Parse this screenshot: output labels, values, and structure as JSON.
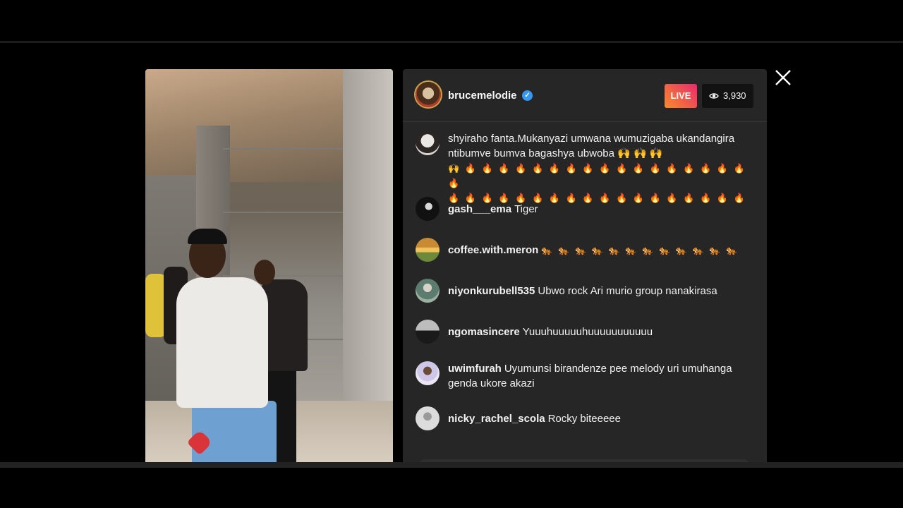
{
  "host": {
    "username": "brucemelodie",
    "verified_icon": "verified-badge-icon",
    "live_label": "LIVE",
    "viewer_count": "3,930"
  },
  "comments": [
    {
      "username": "",
      "text": "shyiraho fanta.Mukanyazi umwana wumuzigaba ukandangira ntibumve bumva bagashya ubwoba 🙌 🙌 🙌",
      "emojis": "🙌 🔥 🔥 🔥 🔥 🔥 🔥 🔥 🔥 🔥 🔥 🔥 🔥 🔥 🔥 🔥 🔥 🔥 🔥\n🔥 🔥 🔥 🔥 🔥 🔥 🔥 🔥 🔥 🔥 🔥 🔥 🔥 🔥 🔥 🔥 🔥 🔥"
    },
    {
      "username": "gash___ema",
      "text": "Tiger"
    },
    {
      "username": "coffee.with.meron",
      "text": "🐅 🐅 🐅 🐅 🐅 🐅 🐅 🐅 🐅 🐅 🐅 🐅"
    },
    {
      "username": "niyonkurubell535",
      "text": "Ubwo rock Ari murio group nanakirasa"
    },
    {
      "username": "ngomasincere",
      "text": "Yuuuhuuuuuhuuuuuuuuuuu"
    },
    {
      "username": "uwimfurah",
      "text": "Uyumunsi birandenze pee melody uri umuhanga genda ukore akazi"
    },
    {
      "username": "nicky_rachel_scola",
      "text": "Rocky biteeeee"
    }
  ],
  "colors": {
    "panel_bg": "#262626",
    "live_gradient_start": "#f78c2b",
    "live_gradient_end": "#ea2a6d",
    "verified_blue": "#3897f0"
  },
  "icons": {
    "close": "close-icon",
    "viewers": "eye-icon"
  }
}
